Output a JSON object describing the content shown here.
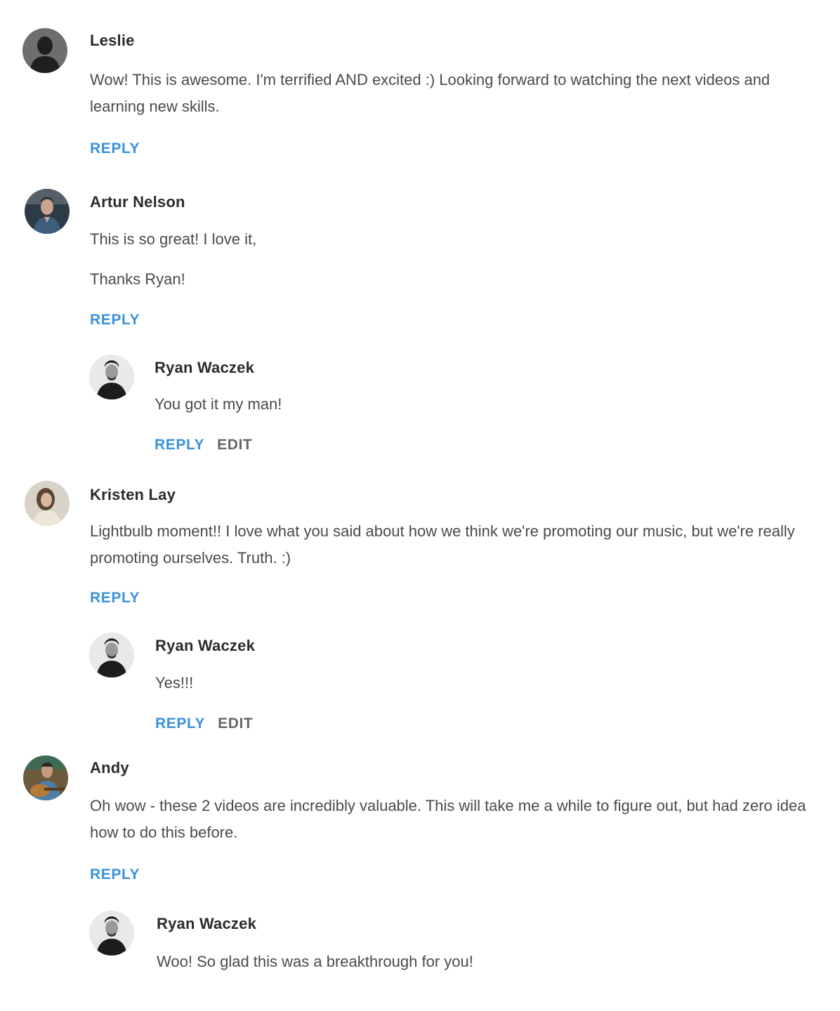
{
  "comments": [
    {
      "author": "Leslie",
      "avatar_icon": "default-silhouette-icon",
      "paragraphs": [
        "Wow! This is awesome. I'm terrified AND excited :) Looking forward to watching the next videos and learning new skills."
      ],
      "reply_label": "REPLY"
    },
    {
      "author": "Artur Nelson",
      "avatar_icon": "user-photo-icon",
      "paragraphs": [
        "This is so great! I love it,",
        "Thanks Ryan!"
      ],
      "reply_label": "REPLY",
      "replies": [
        {
          "author": "Ryan Waczek",
          "avatar_icon": "user-photo-icon",
          "paragraphs": [
            "You got it my man!"
          ],
          "reply_label": "REPLY",
          "edit_label": "EDIT"
        }
      ]
    },
    {
      "author": "Kristen Lay",
      "avatar_icon": "user-photo-icon",
      "paragraphs": [
        "Lightbulb moment!! I love what you said about how we think we're promoting our music, but we're really promoting ourselves. Truth. :)"
      ],
      "reply_label": "REPLY",
      "replies": [
        {
          "author": "Ryan Waczek",
          "avatar_icon": "user-photo-icon",
          "paragraphs": [
            "Yes!!!"
          ],
          "reply_label": "REPLY",
          "edit_label": "EDIT"
        }
      ]
    },
    {
      "author": "Andy",
      "avatar_icon": "user-photo-icon",
      "paragraphs": [
        "Oh wow - these 2 videos are incredibly valuable. This will take me a while to figure out, but had zero idea how to do this before."
      ],
      "reply_label": "REPLY",
      "replies": [
        {
          "author": "Ryan Waczek",
          "avatar_icon": "user-photo-icon",
          "paragraphs": [
            "Woo! So glad this was a breakthrough for you!"
          ]
        }
      ]
    }
  ],
  "colors": {
    "link": "#3a92dd",
    "edit": "#666666",
    "author": "#2b2b2b",
    "text": "#4a4a4a"
  }
}
